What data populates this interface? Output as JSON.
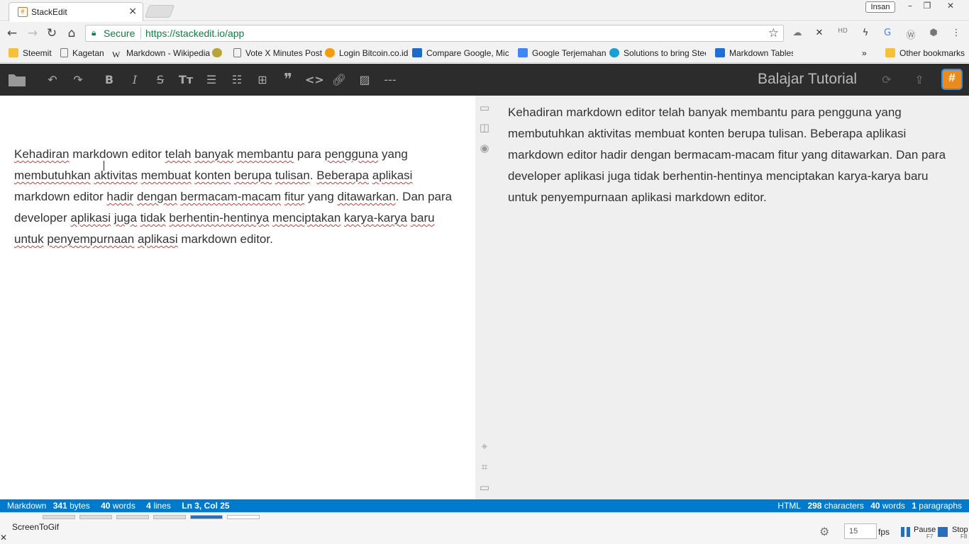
{
  "browser": {
    "tab": {
      "favicon": "#",
      "title": "StackEdit",
      "close": "×"
    },
    "profile": "Insan",
    "window_controls": {
      "minimize": "–",
      "maximize": "❐",
      "close": "✕"
    },
    "address": {
      "secure_label": "Secure",
      "url": "https://stackedit.io/app"
    },
    "bookmarks": [
      {
        "label": "Steemit",
        "icon": "folder-icon",
        "color": "#f3c13a"
      },
      {
        "label": "Kagetan",
        "icon": "page-icon",
        "color": "#ffffff"
      },
      {
        "label": "Markdown - Wikipedia",
        "icon": "wikipedia-icon",
        "color": "#ffffff"
      },
      {
        "label": "",
        "icon": "coin-icon",
        "color": "#b7a43b"
      },
      {
        "label": "Vote X Minutes Post",
        "icon": "page-icon",
        "color": "#ffffff"
      },
      {
        "label": "Login Bitcoin.co.id",
        "icon": "bitcoin-icon",
        "color": "#f39c12"
      },
      {
        "label": "Compare Google, Micros",
        "icon": "compare-icon",
        "color": "#1d6ac7"
      },
      {
        "label": "Google Terjemahan",
        "icon": "translate-icon",
        "color": "#4285f4"
      },
      {
        "label": "Solutions to bring Steem",
        "icon": "steem-icon",
        "color": "#1a9fd6"
      },
      {
        "label": "Markdown Tables gener",
        "icon": "table-icon",
        "color": "#1e6fd8"
      },
      {
        "label": "Other bookmarks",
        "icon": "folder-icon",
        "color": "#f3c13a"
      }
    ],
    "bookmarks_overflow": "»"
  },
  "stackedit": {
    "document_title": "Balajar Tutorial",
    "editor_text": [
      [
        {
          "t": "Kehadiran",
          "m": true
        },
        {
          "t": " markdown editor "
        },
        {
          "t": "telah",
          "m": true
        },
        {
          "t": " "
        },
        {
          "t": "banyak",
          "m": true
        },
        {
          "t": " "
        },
        {
          "t": "membantu",
          "m": true
        },
        {
          "t": " para "
        },
        {
          "t": "pengguna",
          "m": true
        },
        {
          "t": " yang "
        },
        {
          "t": "membutuhkan",
          "m": true
        },
        {
          "t": " "
        },
        {
          "t": "aktivitas",
          "m": true
        },
        {
          "t": " "
        },
        {
          "t": "membuat",
          "m": true
        },
        {
          "t": " "
        },
        {
          "t": "konten",
          "m": true
        },
        {
          "t": " "
        },
        {
          "t": "berupa",
          "m": true
        },
        {
          "t": " "
        },
        {
          "t": "tulisan",
          "m": true
        },
        {
          "t": ". "
        },
        {
          "t": "Beberapa",
          "m": true
        },
        {
          "t": " "
        },
        {
          "t": "aplikasi",
          "m": true
        },
        {
          "t": " markdown editor "
        },
        {
          "t": "hadir",
          "m": true
        },
        {
          "t": " "
        },
        {
          "t": "dengan",
          "m": true
        },
        {
          "t": " "
        },
        {
          "t": "bermacam-macam",
          "m": true
        },
        {
          "t": " "
        },
        {
          "t": "fitur",
          "m": true
        },
        {
          "t": " yang "
        },
        {
          "t": "ditawarkan",
          "m": true
        },
        {
          "t": ". Dan para developer "
        },
        {
          "t": "aplikasi",
          "m": true
        },
        {
          "t": " "
        },
        {
          "t": "juga",
          "m": true
        },
        {
          "t": " "
        },
        {
          "t": "tidak",
          "m": true
        },
        {
          "t": " "
        },
        {
          "t": "berhentin-hentinya",
          "m": true
        },
        {
          "t": " "
        },
        {
          "t": "menciptakan",
          "m": true
        },
        {
          "t": " "
        },
        {
          "t": "karya-karya",
          "m": true
        },
        {
          "t": " "
        },
        {
          "t": "baru",
          "m": true
        },
        {
          "t": " "
        },
        {
          "t": "untuk",
          "m": true
        },
        {
          "t": " "
        },
        {
          "t": "penyempurnaan",
          "m": true
        },
        {
          "t": " "
        },
        {
          "t": "aplikasi",
          "m": true
        },
        {
          "t": " markdown editor."
        }
      ]
    ],
    "preview_text": "Kehadiran markdown editor telah banyak membantu para pengguna yang membutuhkan aktivitas membuat konten berupa tulisan. Beberapa aplikasi markdown editor hadir dengan bermacam-macam fitur yang ditawarkan. Dan para developer aplikasi juga tidak berhentin-hentinya menciptakan karya-karya baru untuk penyempurnaan aplikasi markdown editor.",
    "status_left": {
      "mode": "Markdown",
      "bytes_num": "341",
      "bytes_label": "bytes",
      "words_num": "40",
      "words_label": "words",
      "lines_num": "4",
      "lines_label": "lines",
      "position": "Ln 3, Col 25"
    },
    "status_right": {
      "mode": "HTML",
      "chars_num": "298",
      "chars_label": "characters",
      "words_num": "40",
      "words_label": "words",
      "paragraphs_num": "1",
      "paragraphs_label": "paragraphs"
    },
    "status_color": "#007acc"
  },
  "screentogif": {
    "title": "ScreenToGif",
    "close": "✕",
    "fps_value": "15",
    "fps_label": "fps",
    "pause_label": "Pause",
    "pause_key": "F7",
    "stop_label": "Stop",
    "stop_key": "F8"
  }
}
